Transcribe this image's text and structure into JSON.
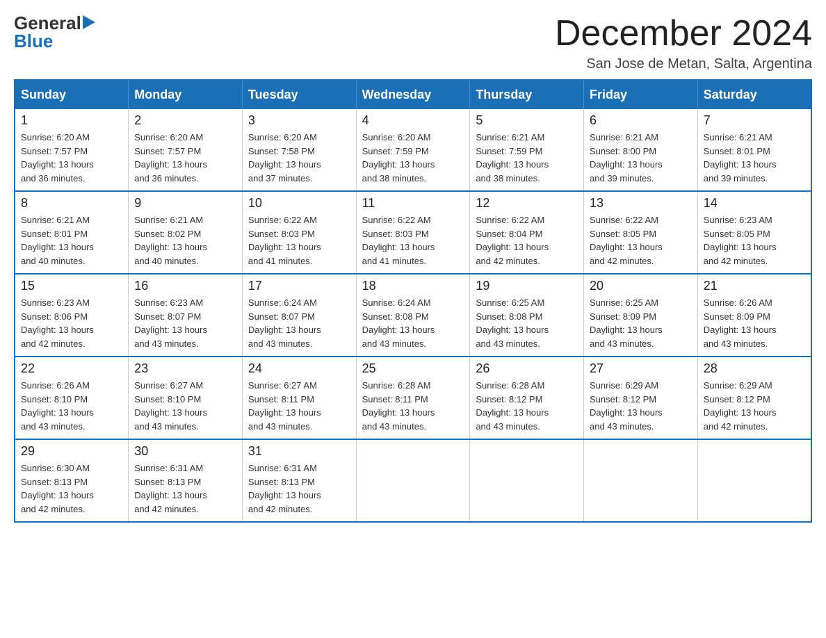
{
  "logo": {
    "general": "General",
    "blue": "Blue",
    "arrow": "▶"
  },
  "header": {
    "title": "December 2024",
    "location": "San Jose de Metan, Salta, Argentina"
  },
  "days_of_week": [
    "Sunday",
    "Monday",
    "Tuesday",
    "Wednesday",
    "Thursday",
    "Friday",
    "Saturday"
  ],
  "weeks": [
    [
      {
        "day": "1",
        "sunrise": "6:20 AM",
        "sunset": "7:57 PM",
        "daylight": "13 hours and 36 minutes."
      },
      {
        "day": "2",
        "sunrise": "6:20 AM",
        "sunset": "7:57 PM",
        "daylight": "13 hours and 36 minutes."
      },
      {
        "day": "3",
        "sunrise": "6:20 AM",
        "sunset": "7:58 PM",
        "daylight": "13 hours and 37 minutes."
      },
      {
        "day": "4",
        "sunrise": "6:20 AM",
        "sunset": "7:59 PM",
        "daylight": "13 hours and 38 minutes."
      },
      {
        "day": "5",
        "sunrise": "6:21 AM",
        "sunset": "7:59 PM",
        "daylight": "13 hours and 38 minutes."
      },
      {
        "day": "6",
        "sunrise": "6:21 AM",
        "sunset": "8:00 PM",
        "daylight": "13 hours and 39 minutes."
      },
      {
        "day": "7",
        "sunrise": "6:21 AM",
        "sunset": "8:01 PM",
        "daylight": "13 hours and 39 minutes."
      }
    ],
    [
      {
        "day": "8",
        "sunrise": "6:21 AM",
        "sunset": "8:01 PM",
        "daylight": "13 hours and 40 minutes."
      },
      {
        "day": "9",
        "sunrise": "6:21 AM",
        "sunset": "8:02 PM",
        "daylight": "13 hours and 40 minutes."
      },
      {
        "day": "10",
        "sunrise": "6:22 AM",
        "sunset": "8:03 PM",
        "daylight": "13 hours and 41 minutes."
      },
      {
        "day": "11",
        "sunrise": "6:22 AM",
        "sunset": "8:03 PM",
        "daylight": "13 hours and 41 minutes."
      },
      {
        "day": "12",
        "sunrise": "6:22 AM",
        "sunset": "8:04 PM",
        "daylight": "13 hours and 42 minutes."
      },
      {
        "day": "13",
        "sunrise": "6:22 AM",
        "sunset": "8:05 PM",
        "daylight": "13 hours and 42 minutes."
      },
      {
        "day": "14",
        "sunrise": "6:23 AM",
        "sunset": "8:05 PM",
        "daylight": "13 hours and 42 minutes."
      }
    ],
    [
      {
        "day": "15",
        "sunrise": "6:23 AM",
        "sunset": "8:06 PM",
        "daylight": "13 hours and 42 minutes."
      },
      {
        "day": "16",
        "sunrise": "6:23 AM",
        "sunset": "8:07 PM",
        "daylight": "13 hours and 43 minutes."
      },
      {
        "day": "17",
        "sunrise": "6:24 AM",
        "sunset": "8:07 PM",
        "daylight": "13 hours and 43 minutes."
      },
      {
        "day": "18",
        "sunrise": "6:24 AM",
        "sunset": "8:08 PM",
        "daylight": "13 hours and 43 minutes."
      },
      {
        "day": "19",
        "sunrise": "6:25 AM",
        "sunset": "8:08 PM",
        "daylight": "13 hours and 43 minutes."
      },
      {
        "day": "20",
        "sunrise": "6:25 AM",
        "sunset": "8:09 PM",
        "daylight": "13 hours and 43 minutes."
      },
      {
        "day": "21",
        "sunrise": "6:26 AM",
        "sunset": "8:09 PM",
        "daylight": "13 hours and 43 minutes."
      }
    ],
    [
      {
        "day": "22",
        "sunrise": "6:26 AM",
        "sunset": "8:10 PM",
        "daylight": "13 hours and 43 minutes."
      },
      {
        "day": "23",
        "sunrise": "6:27 AM",
        "sunset": "8:10 PM",
        "daylight": "13 hours and 43 minutes."
      },
      {
        "day": "24",
        "sunrise": "6:27 AM",
        "sunset": "8:11 PM",
        "daylight": "13 hours and 43 minutes."
      },
      {
        "day": "25",
        "sunrise": "6:28 AM",
        "sunset": "8:11 PM",
        "daylight": "13 hours and 43 minutes."
      },
      {
        "day": "26",
        "sunrise": "6:28 AM",
        "sunset": "8:12 PM",
        "daylight": "13 hours and 43 minutes."
      },
      {
        "day": "27",
        "sunrise": "6:29 AM",
        "sunset": "8:12 PM",
        "daylight": "13 hours and 43 minutes."
      },
      {
        "day": "28",
        "sunrise": "6:29 AM",
        "sunset": "8:12 PM",
        "daylight": "13 hours and 42 minutes."
      }
    ],
    [
      {
        "day": "29",
        "sunrise": "6:30 AM",
        "sunset": "8:13 PM",
        "daylight": "13 hours and 42 minutes."
      },
      {
        "day": "30",
        "sunrise": "6:31 AM",
        "sunset": "8:13 PM",
        "daylight": "13 hours and 42 minutes."
      },
      {
        "day": "31",
        "sunrise": "6:31 AM",
        "sunset": "8:13 PM",
        "daylight": "13 hours and 42 minutes."
      },
      null,
      null,
      null,
      null
    ]
  ],
  "labels": {
    "sunrise": "Sunrise:",
    "sunset": "Sunset:",
    "daylight": "Daylight:"
  }
}
